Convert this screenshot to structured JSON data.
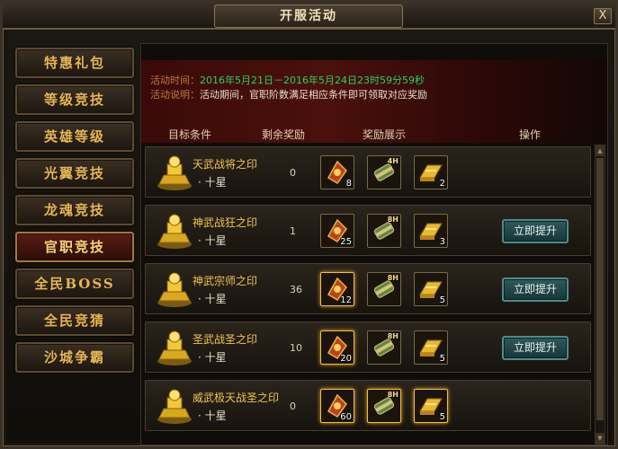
{
  "window": {
    "title": "开服活动",
    "close_label": "X"
  },
  "menu": [
    {
      "label": "特惠礼包",
      "active": false
    },
    {
      "label": "等级竞技",
      "active": false
    },
    {
      "label": "英雄等级",
      "active": false
    },
    {
      "label": "光翼竞技",
      "active": false
    },
    {
      "label": "龙魂竞技",
      "active": false
    },
    {
      "label": "官职竞技",
      "active": true
    },
    {
      "label": "全民BOSS",
      "active": false
    },
    {
      "label": "全民竞猜",
      "active": false
    },
    {
      "label": "沙城争霸",
      "active": false
    }
  ],
  "banner": {
    "time_label": "活动时间：",
    "time_value": "2016年5月21日－2016年5月24日23时59分59秒",
    "desc_label": "活动说明：",
    "desc_value": "活动期间，官职阶数满足相应条件即可领取对应奖励"
  },
  "table": {
    "headers": {
      "target": "目标条件",
      "remaining": "剩余奖励",
      "rewards": "奖励展示",
      "action": "操作"
    },
    "rows": [
      {
        "name": "天武战将之印",
        "star": "· 十星",
        "remaining": "0",
        "rewards": [
          {
            "icon": "seal-scroll-icon",
            "count": "8",
            "tag": ""
          },
          {
            "icon": "scroll-4h-icon",
            "count": "",
            "tag": "4H"
          },
          {
            "icon": "gold-bar-icon",
            "count": "2",
            "tag": ""
          }
        ],
        "button": ""
      },
      {
        "name": "神武战狂之印",
        "star": "· 十星",
        "remaining": "1",
        "rewards": [
          {
            "icon": "seal-scroll-icon",
            "count": "25",
            "tag": ""
          },
          {
            "icon": "scroll-8h-icon",
            "count": "",
            "tag": "8H"
          },
          {
            "icon": "gold-bar-icon",
            "count": "3",
            "tag": ""
          }
        ],
        "button": "立即提升"
      },
      {
        "name": "神武宗师之印",
        "star": "· 十星",
        "remaining": "36",
        "rewards": [
          {
            "icon": "seal-scroll-icon",
            "count": "12",
            "tag": ""
          },
          {
            "icon": "scroll-8h-icon",
            "count": "",
            "tag": "8H"
          },
          {
            "icon": "gold-bar-icon",
            "count": "5",
            "tag": ""
          }
        ],
        "button": "立即提升"
      },
      {
        "name": "圣武战圣之印",
        "star": "· 十星",
        "remaining": "10",
        "rewards": [
          {
            "icon": "seal-scroll-icon",
            "count": "20",
            "tag": ""
          },
          {
            "icon": "scroll-8h-icon",
            "count": "",
            "tag": "8H"
          },
          {
            "icon": "gold-bar-icon",
            "count": "5",
            "tag": ""
          }
        ],
        "button": "立即提升"
      },
      {
        "name": "威武极天战圣之印",
        "star": "· 十星",
        "remaining": "0",
        "rewards": [
          {
            "icon": "seal-scroll-icon",
            "count": "60",
            "tag": ""
          },
          {
            "icon": "scroll-8h-icon",
            "count": "",
            "tag": "8H"
          },
          {
            "icon": "gold-bar-icon",
            "count": "5",
            "tag": ""
          }
        ],
        "button": ""
      }
    ]
  },
  "colors": {
    "accent_gold": "#f3c44c",
    "banner_red": "#4a100c",
    "time_green": "#2fd05c",
    "button_teal": "#2f5a5e"
  }
}
